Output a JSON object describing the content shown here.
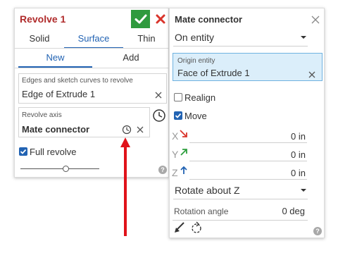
{
  "revolve": {
    "title": "Revolve 1",
    "type_tabs": [
      "Solid",
      "Surface",
      "Thin"
    ],
    "active_type": "Surface",
    "op_tabs": [
      "New",
      "Add"
    ],
    "active_op": "New",
    "edges_label": "Edges and sketch curves to revolve",
    "edges_value": "Edge of Extrude 1",
    "axis_label": "Revolve axis",
    "axis_value": "Mate connector",
    "full_revolve_label": "Full revolve",
    "full_revolve_checked": true,
    "slider_value": 0.58
  },
  "mate_connector": {
    "title": "Mate connector",
    "placement": "On entity",
    "origin_label": "Origin entity",
    "origin_value": "Face of Extrude 1",
    "realign_label": "Realign",
    "realign_checked": false,
    "move_label": "Move",
    "move_checked": true,
    "offsets": [
      {
        "axis": "X",
        "value": "0 in",
        "color": "#d9342b"
      },
      {
        "axis": "Y",
        "value": "0 in",
        "color": "#2e9e3e"
      },
      {
        "axis": "Z",
        "value": "0 in",
        "color": "#2263b3"
      }
    ],
    "rotation_mode": "Rotate about Z",
    "rotation_angle_label": "Rotation angle",
    "rotation_angle_value": "0 deg"
  },
  "colors": {
    "accent": "#2263b3",
    "confirm": "#2f9a3e",
    "cancel": "#d9342b",
    "title_red": "#b02b2b",
    "annotation_arrow": "#e0121a"
  }
}
